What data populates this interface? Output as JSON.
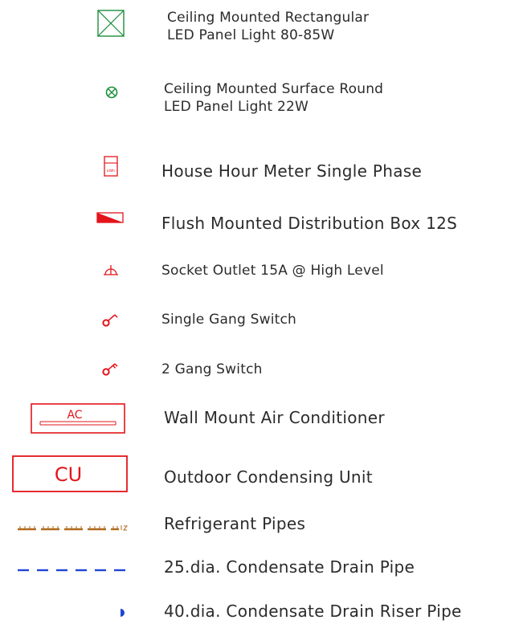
{
  "colors": {
    "green_symbol": "#1a8f3a",
    "red_symbol": "#e3141b",
    "brown_pipe": "#b06a1e",
    "blue_pipe": "#1f45d6",
    "text": "#2b2b2b"
  },
  "legend": {
    "items": [
      {
        "icon": "rectangular-led-panel-icon",
        "lines": [
          "Ceiling Mounted Rectangular",
          "LED Panel Light 80-85W"
        ]
      },
      {
        "icon": "round-led-panel-icon",
        "lines": [
          "Ceiling Mounted Surface Round",
          "LED Panel Light 22W"
        ]
      },
      {
        "icon": "kwh-meter-icon",
        "symbol_text": "kWh",
        "lines": [
          "House Hour Meter Single Phase"
        ]
      },
      {
        "icon": "distribution-box-icon",
        "lines": [
          "Flush Mounted Distribution Box 12S"
        ]
      },
      {
        "icon": "socket-outlet-icon",
        "lines": [
          "Socket Outlet 15A @ High Level"
        ]
      },
      {
        "icon": "single-gang-switch-icon",
        "lines": [
          "Single Gang Switch"
        ]
      },
      {
        "icon": "two-gang-switch-icon",
        "lines": [
          "2 Gang Switch"
        ]
      },
      {
        "icon": "air-conditioner-icon",
        "symbol_text": "AC",
        "lines": [
          "Wall Mount Air Conditioner"
        ]
      },
      {
        "icon": "condensing-unit-icon",
        "symbol_text": "CU",
        "lines": [
          "Outdoor Condensing Unit"
        ]
      },
      {
        "icon": "refrigerant-pipe-icon",
        "lines": [
          "Refrigerant Pipes"
        ]
      },
      {
        "icon": "condensate-drain-pipe-icon",
        "lines": [
          "25.dia. Condensate Drain Pipe"
        ]
      },
      {
        "icon": "drain-riser-pipe-icon",
        "lines": [
          "40.dia. Condensate Drain Riser Pipe"
        ]
      }
    ]
  }
}
